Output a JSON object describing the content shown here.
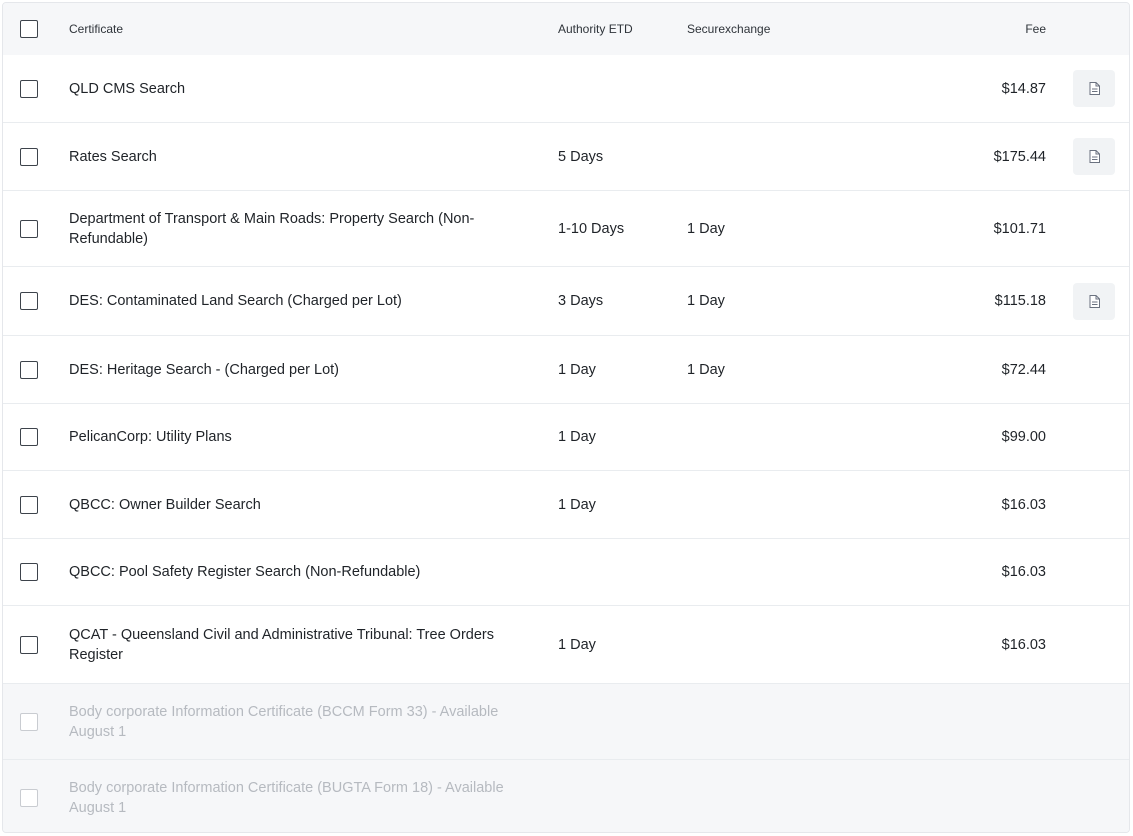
{
  "table": {
    "headers": {
      "certificate": "Certificate",
      "authority_etd": "Authority ETD",
      "securexchange": "Securexchange",
      "fee": "Fee"
    },
    "rows": [
      {
        "name": "QLD CMS Search",
        "etd": "",
        "securexchange": "",
        "fee": "$14.87",
        "has_document": true,
        "disabled": false
      },
      {
        "name": "Rates Search",
        "etd": "5 Days",
        "securexchange": "",
        "fee": "$175.44",
        "has_document": true,
        "disabled": false
      },
      {
        "name": "Department of Transport & Main Roads: Property Search (Non-Refundable)",
        "etd": "1-10 Days",
        "securexchange": "1 Day",
        "fee": "$101.71",
        "has_document": false,
        "disabled": false
      },
      {
        "name": "DES: Contaminated Land Search (Charged per Lot)",
        "etd": "3 Days",
        "securexchange": "1 Day",
        "fee": "$115.18",
        "has_document": true,
        "disabled": false
      },
      {
        "name": "DES: Heritage Search - (Charged per Lot)",
        "etd": "1 Day",
        "securexchange": "1 Day",
        "fee": "$72.44",
        "has_document": false,
        "disabled": false
      },
      {
        "name": "PelicanCorp: Utility Plans",
        "etd": "1 Day",
        "securexchange": "",
        "fee": "$99.00",
        "has_document": false,
        "disabled": false
      },
      {
        "name": "QBCC: Owner Builder Search",
        "etd": "1 Day",
        "securexchange": "",
        "fee": "$16.03",
        "has_document": false,
        "disabled": false
      },
      {
        "name": "QBCC: Pool Safety Register Search (Non-Refundable)",
        "etd": "",
        "securexchange": "",
        "fee": "$16.03",
        "has_document": false,
        "disabled": false
      },
      {
        "name": "QCAT - Queensland Civil and Administrative Tribunal: Tree Orders Register",
        "etd": "1 Day",
        "securexchange": "",
        "fee": "$16.03",
        "has_document": false,
        "disabled": false
      },
      {
        "name": "Body corporate Information Certificate (BCCM Form 33) - Available August 1",
        "etd": "",
        "securexchange": "",
        "fee": "",
        "has_document": false,
        "disabled": true
      },
      {
        "name": "Body corporate Information Certificate (BUGTA Form 18) - Available August 1",
        "etd": "",
        "securexchange": "",
        "fee": "",
        "has_document": false,
        "disabled": true
      }
    ]
  },
  "icons": {
    "row_action": "document-icon",
    "checkbox": "checkbox-icon"
  },
  "colors": {
    "header_bg": "#f6f7f9",
    "disabled_text": "#b6bac0",
    "border": "#e9ecef"
  }
}
